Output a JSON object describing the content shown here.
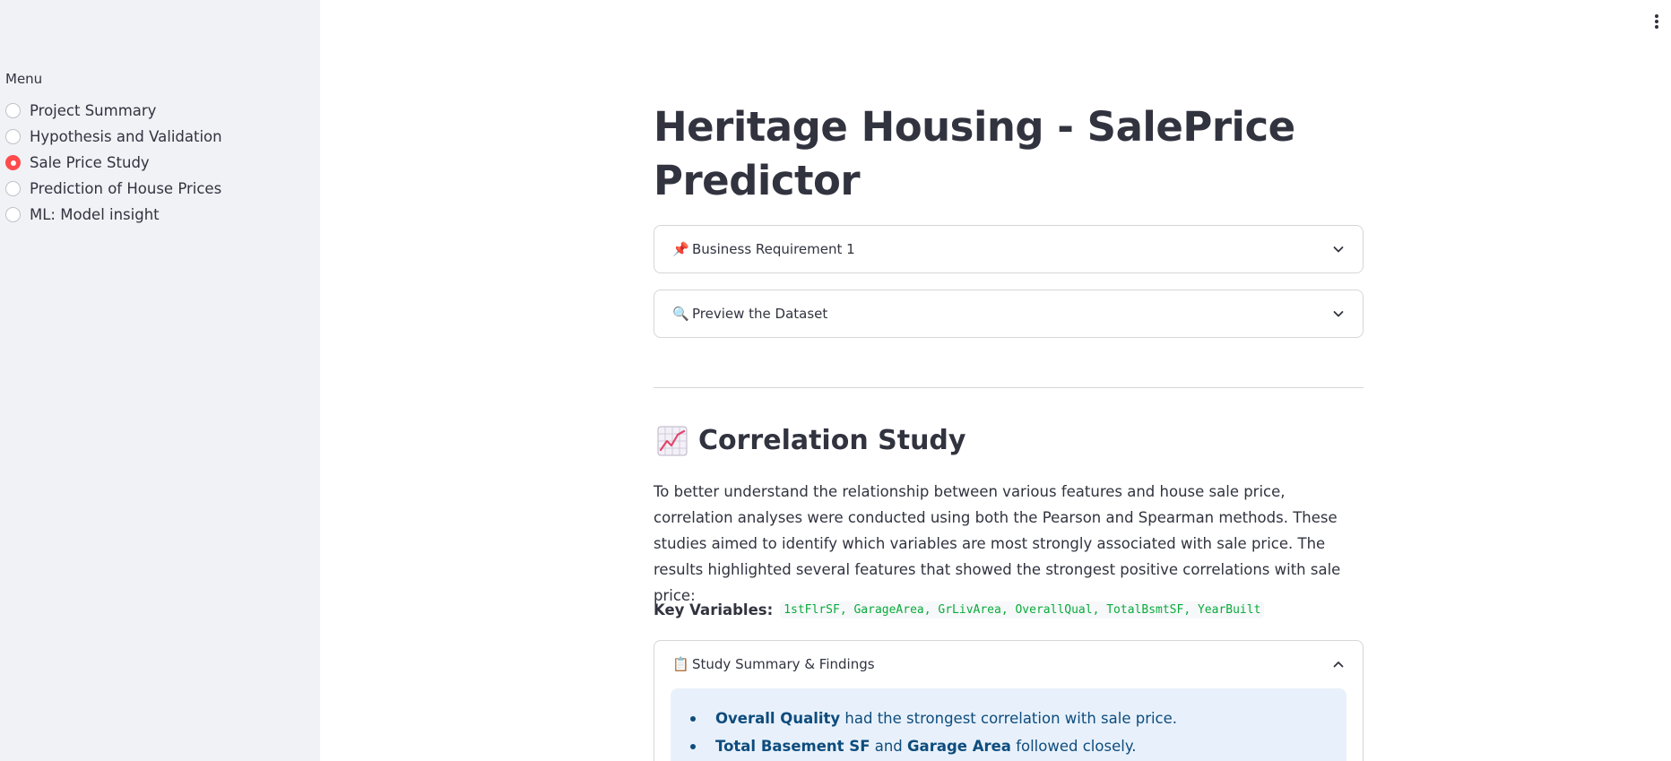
{
  "sidebar": {
    "menu_label": "Menu",
    "items": [
      {
        "label": "Project Summary",
        "selected": false
      },
      {
        "label": "Hypothesis and Validation",
        "selected": false
      },
      {
        "label": "Sale Price Study",
        "selected": true
      },
      {
        "label": "Prediction of House Prices",
        "selected": false
      },
      {
        "label": "ML: Model insight",
        "selected": false
      }
    ]
  },
  "main": {
    "title": "Heritage Housing - SalePrice Predictor",
    "expanders": [
      {
        "icon": "📌",
        "icon_name": "pushpin-icon",
        "label": "Business Requirement 1",
        "expanded": false
      },
      {
        "icon": "🔍",
        "icon_name": "magnifier-icon",
        "label": "Preview the Dataset",
        "expanded": false
      }
    ],
    "section": {
      "icon_name": "chart-increasing-icon",
      "heading": "Correlation Study",
      "paragraph": "To better understand the relationship between various features and house sale price, correlation analyses were conducted using both the Pearson and Spearman methods. These studies aimed to identify which variables are most strongly associated with sale price. The results highlighted several features that showed the strongest positive correlations with sale price:",
      "key_label": "Key Variables:",
      "key_code": "1stFlrSF, GarageArea, GrLivArea, OverallQual, TotalBsmtSF, YearBuilt"
    },
    "findings_expander": {
      "icon": "📋",
      "icon_name": "clipboard-icon",
      "label": "Study Summary & Findings",
      "expanded": true,
      "items": [
        {
          "bold1": "Overall Quality",
          "mid": "",
          "bold2": "",
          "rest": " had the strongest correlation with sale price."
        },
        {
          "bold1": "Total Basement SF",
          "mid": " and ",
          "bold2": "Garage Area",
          "rest": " followed closely."
        }
      ]
    }
  },
  "colors": {
    "sidebar_bg": "#f0f2f6",
    "accent": "#ff4b4b",
    "code_green": "#09ab3b",
    "info_bg": "#e8f1fb",
    "info_text": "#0e4c7d"
  }
}
